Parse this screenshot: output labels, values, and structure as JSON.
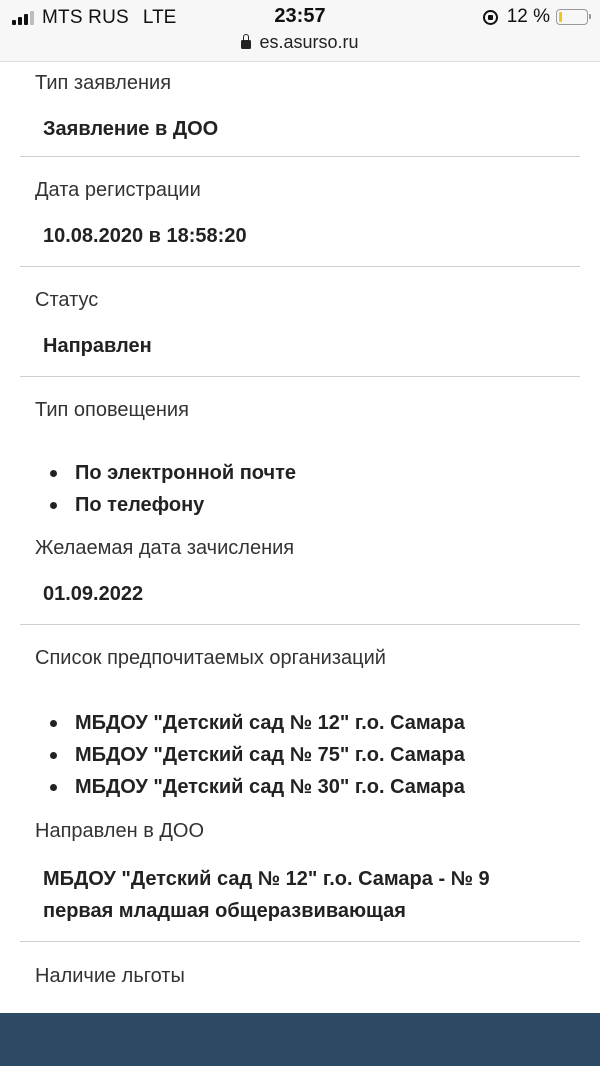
{
  "status_bar": {
    "carrier": "MTS RUS",
    "network": "LTE",
    "time": "23:57",
    "battery_text": "12 %",
    "battery_level": 0.12,
    "battery_color": "#f0c419",
    "url": "es.asurso.ru"
  },
  "fields": {
    "application_type": {
      "label": "Тип заявления",
      "value": "Заявление в ДОО"
    },
    "registration_date": {
      "label": "Дата регистрации",
      "value": "10.08.2020 в 18:58:20"
    },
    "status": {
      "label": "Статус",
      "value": "Направлен"
    },
    "notification_type": {
      "label": "Тип оповещения",
      "items": [
        "По электронной почте",
        "По телефону"
      ]
    },
    "desired_enrollment_date": {
      "label": "Желаемая дата зачисления",
      "value": "01.09.2022"
    },
    "preferred_organizations": {
      "label": "Список предпочитаемых организаций",
      "items": [
        "МБДОУ \"Детский сад № 12\" г.о. Самара",
        "МБДОУ \"Детский сад № 75\" г.о. Самара",
        "МБДОУ \"Детский сад № 30\" г.о. Самара"
      ]
    },
    "directed_to": {
      "label": "Направлен в ДОО",
      "value_line1": "МБДОУ \"Детский сад № 12\" г.о. Самара - № 9",
      "value_line2": "первая младшая общеразвивающая"
    },
    "benefit": {
      "label": "Наличие льготы"
    }
  },
  "colors": {
    "bottom_bar": "#2c4a63",
    "divider": "#cfcfcf"
  }
}
